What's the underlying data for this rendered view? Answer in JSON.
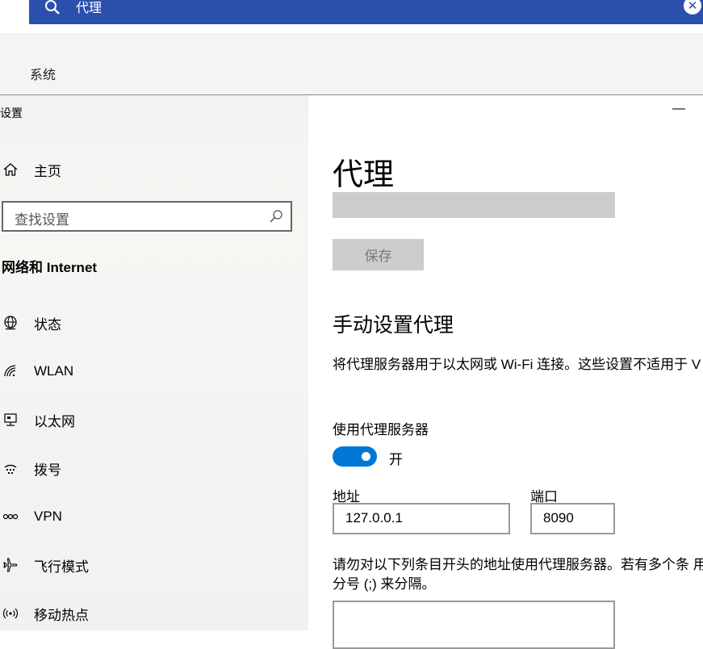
{
  "top_search": {
    "query": "代理",
    "icons": [
      "search-icon",
      "clear-icon"
    ]
  },
  "background_app": {
    "label": "系统"
  },
  "window": {
    "title": "设置",
    "minimize_label": "—"
  },
  "sidebar": {
    "home_label": "主页",
    "search_placeholder": "查找设置",
    "section_title": "网络和 Internet",
    "items": [
      {
        "label": "状态",
        "icon": "globe-status-icon"
      },
      {
        "label": "WLAN",
        "icon": "wifi-icon"
      },
      {
        "label": "以太网",
        "icon": "ethernet-icon"
      },
      {
        "label": "拨号",
        "icon": "dialup-icon"
      },
      {
        "label": "VPN",
        "icon": "vpn-icon"
      },
      {
        "label": "飞行模式",
        "icon": "airplane-icon"
      },
      {
        "label": "移动热点",
        "icon": "hotspot-icon"
      }
    ]
  },
  "main": {
    "title": "代理",
    "save_label": "保存",
    "manual_title": "手动设置代理",
    "description": "将代理服务器用于以太网或 Wi-Fi 连接。这些设置不适用于 V 接。",
    "use_proxy_label": "使用代理服务器",
    "toggle_state": "开",
    "toggle_on": true,
    "address_label": "地址",
    "address_value": "127.0.0.1",
    "port_label": "端口",
    "port_value": "8090",
    "exceptions_description": "请勿对以下列条目开头的地址使用代理服务器。若有多个条 用英文分号 (;) 来分隔。",
    "exceptions_value": "",
    "accent_color": "#0078d7"
  }
}
